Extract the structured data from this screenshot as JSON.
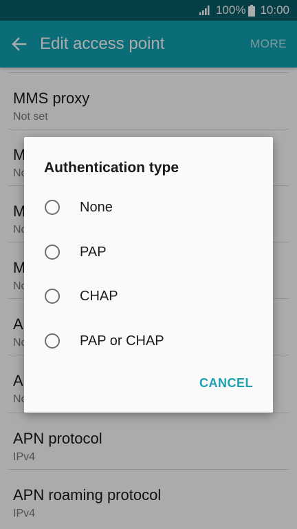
{
  "status_bar": {
    "battery": "100%",
    "time": "10:00",
    "signal_icon": "signal-icon",
    "battery_icon": "battery-icon"
  },
  "app_bar": {
    "title": "Edit access point",
    "more_label": "MORE",
    "back_icon": "back-arrow-icon"
  },
  "settings": {
    "items": [
      {
        "title": "MMS proxy",
        "value": "Not set"
      },
      {
        "title": "M",
        "value": "No"
      },
      {
        "title": "M",
        "value": "No"
      },
      {
        "title": "M",
        "value": "No"
      },
      {
        "title": "A",
        "value": "No"
      },
      {
        "title": "A",
        "value": "No"
      },
      {
        "title": "APN protocol",
        "value": "IPv4"
      },
      {
        "title": "APN roaming protocol",
        "value": "IPv4"
      }
    ]
  },
  "dialog": {
    "title": "Authentication type",
    "options": [
      {
        "label": "None"
      },
      {
        "label": "PAP"
      },
      {
        "label": "CHAP"
      },
      {
        "label": "PAP or CHAP"
      }
    ],
    "cancel_label": "CANCEL"
  },
  "colors": {
    "status_bar": "#0b5f6a",
    "app_bar": "#11a3b3",
    "accent": "#1aa1b1"
  }
}
